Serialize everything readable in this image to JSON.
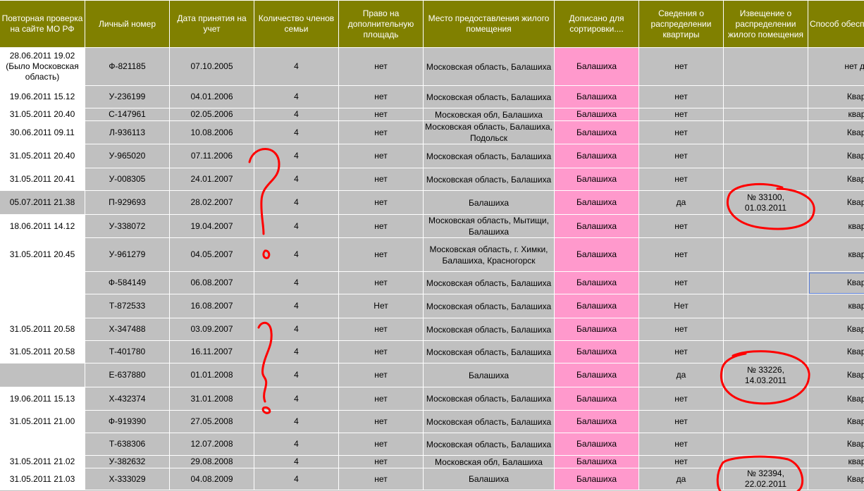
{
  "columns": [
    "Повторная проверка на сайте МО РФ",
    "Личный номер",
    "Дата принятия на учет",
    "Количество членов семьи",
    "Право на дополнительную площадь",
    "Место предоставления жилого помещения",
    "Дописано для сортировки....",
    "Сведения о распределении квартиры",
    "Извещение о распределении жилого помещения",
    "Способ обеспечения жильем"
  ],
  "rows": [
    {
      "recheck": "28.06.2011 19.02 (Было Московская область)",
      "id": "Ф-821185",
      "date": "07.10.2005",
      "family": "4",
      "extra": "нет",
      "place": "Московская область, Балашиха",
      "sort": "Балашиха",
      "distributed": "нет",
      "notice": "",
      "method": "нет данн"
    },
    {
      "recheck": "19.06.2011 15.12",
      "id": "У-236199",
      "date": "04.01.2006",
      "family": "4",
      "extra": "нет",
      "place": "Московская область, Балашиха",
      "sort": "Балашиха",
      "distributed": "нет",
      "notice": "",
      "method": "Квартир"
    },
    {
      "recheck": "31.05.2011 20.40",
      "id": "С-147961",
      "date": "02.05.2006",
      "family": "4",
      "extra": "нет",
      "place": "Московская обл, Балашиха",
      "sort": "Балашиха",
      "distributed": "нет",
      "notice": "",
      "method": "квартир"
    },
    {
      "recheck": "30.06.2011 09.11",
      "id": "Л-936113",
      "date": "10.08.2006",
      "family": "4",
      "extra": "нет",
      "place": "Московская область, Балашиха, Подольск",
      "sort": "Балашиха",
      "distributed": "нет",
      "notice": "",
      "method": "Квартир"
    },
    {
      "recheck": "31.05.2011 20.40",
      "id": "У-965020",
      "date": "07.11.2006",
      "family": "4",
      "extra": "нет",
      "place": "Московская область, Балашиха",
      "sort": "Балашиха",
      "distributed": "нет",
      "notice": "",
      "method": "Квартир"
    },
    {
      "recheck": "31.05.2011 20.41",
      "id": "У-008305",
      "date": "24.01.2007",
      "family": "4",
      "extra": "нет",
      "place": "Московская область, Балашиха",
      "sort": "Балашиха",
      "distributed": "нет",
      "notice": "",
      "method": "Квартир"
    },
    {
      "recheck": "05.07.2011 21.38",
      "id": "П-929693",
      "date": "28.02.2007",
      "family": "4",
      "extra": "нет",
      "place": "Балашиха",
      "sort": "Балашиха",
      "distributed": "да",
      "notice": "№ 33100, 01.03.2011",
      "method": "Квартир"
    },
    {
      "recheck": "18.06.2011 14.12",
      "id": "У-338072",
      "date": "19.04.2007",
      "family": "4",
      "extra": "нет",
      "place": "Московская область, Мытищи, Балашиха",
      "sort": "Балашиха",
      "distributed": "нет",
      "notice": "",
      "method": "квартир"
    },
    {
      "recheck": "31.05.2011 20.45",
      "id": "У-961279",
      "date": "04.05.2007",
      "family": "4",
      "extra": "нет",
      "place": "Московская область, г. Химки, Балашиха, Красногорск",
      "sort": "Балашиха",
      "distributed": "нет",
      "notice": "",
      "method": "квартир"
    },
    {
      "recheck": "",
      "id": "Ф-584149",
      "date": "06.08.2007",
      "family": "4",
      "extra": "нет",
      "place": "Московская область, Балашиха",
      "sort": "Балашиха",
      "distributed": "нет",
      "notice": "",
      "method": "Квартир"
    },
    {
      "recheck": "",
      "id": "Т-872533",
      "date": "16.08.2007",
      "family": "4",
      "extra": "Нет",
      "place": "Московская область, Балашиха",
      "sort": "Балашиха",
      "distributed": "Нет",
      "notice": "",
      "method": "квартир"
    },
    {
      "recheck": "31.05.2011 20.58",
      "id": "Х-347488",
      "date": "03.09.2007",
      "family": "4",
      "extra": "нет",
      "place": "Московская область, Балашиха",
      "sort": "Балашиха",
      "distributed": "нет",
      "notice": "",
      "method": "Квартир"
    },
    {
      "recheck": "31.05.2011 20.58",
      "id": "Т-401780",
      "date": "16.11.2007",
      "family": "4",
      "extra": "нет",
      "place": "Московская область, Балашиха",
      "sort": "Балашиха",
      "distributed": "нет",
      "notice": "",
      "method": "Квартир"
    },
    {
      "recheck": "",
      "id": "Е-637880",
      "date": "01.01.2008",
      "family": "4",
      "extra": "нет",
      "place": "Балашиха",
      "sort": "Балашиха",
      "distributed": "да",
      "notice": "№ 33226, 14.03.2011",
      "method": "Квартир"
    },
    {
      "recheck": "19.06.2011 15.13",
      "id": "Х-432374",
      "date": "31.01.2008",
      "family": "4",
      "extra": "нет",
      "place": "Московская область, Балашиха",
      "sort": "Балашиха",
      "distributed": "нет",
      "notice": "",
      "method": "Квартир"
    },
    {
      "recheck": "31.05.2011 21.00",
      "id": "Ф-919390",
      "date": "27.05.2008",
      "family": "4",
      "extra": "нет",
      "place": "Московская область, Балашиха",
      "sort": "Балашиха",
      "distributed": "нет",
      "notice": "",
      "method": "Квартир"
    },
    {
      "recheck": "",
      "id": "Т-638306",
      "date": "12.07.2008",
      "family": "4",
      "extra": "нет",
      "place": "Московская область, Балашиха",
      "sort": "Балашиха",
      "distributed": "нет",
      "notice": "",
      "method": "Квартир"
    },
    {
      "recheck": "31.05.2011 21.02",
      "id": "У-382632",
      "date": "29.08.2008",
      "family": "4",
      "extra": "нет",
      "place": "Московская обл, Балашиха",
      "sort": "Балашиха",
      "distributed": "нет",
      "notice": "",
      "method": "квартир"
    },
    {
      "recheck": "31.05.2011 21.03",
      "id": "Х-333029",
      "date": "04.08.2009",
      "family": "4",
      "extra": "нет",
      "place": "Балашиха",
      "sort": "Балашиха",
      "distributed": "да",
      "notice": "№ 32394, 22.02.2011",
      "method": "Квартир"
    }
  ],
  "annotations": {
    "color": "#ff0000"
  }
}
